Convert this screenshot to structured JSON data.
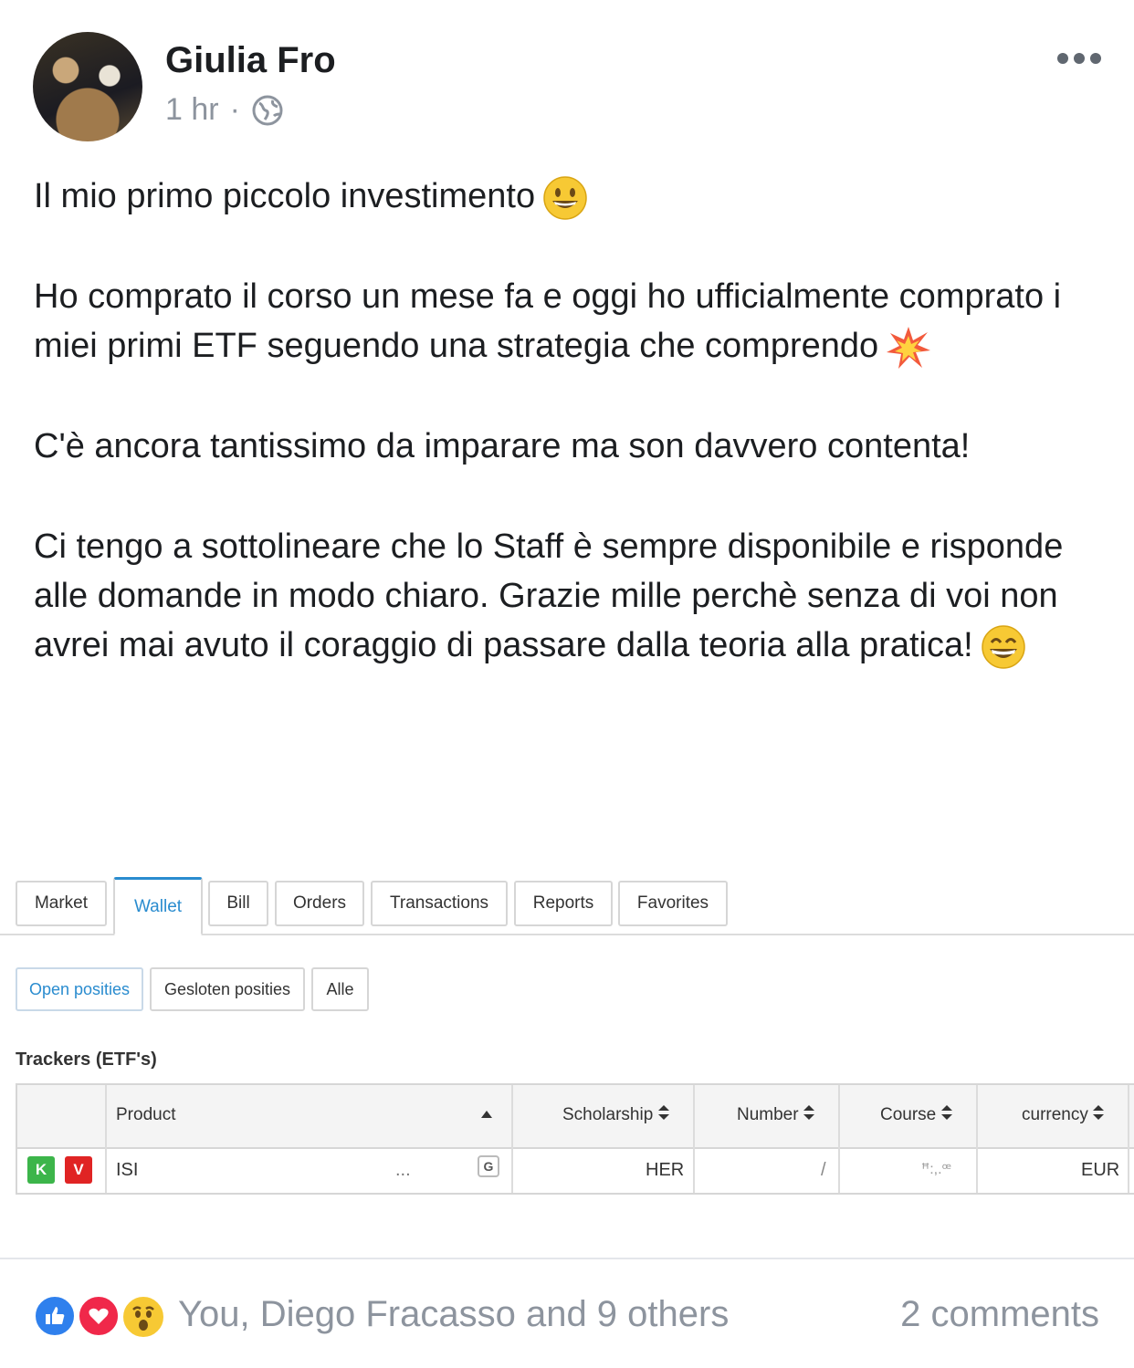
{
  "post": {
    "author": "Giulia Fro",
    "time": "1 hr",
    "separator": "·",
    "privacy_icon": "globe-icon",
    "more_icon": "more-options-icon",
    "paragraphs": [
      "Il mio primo piccolo investimento",
      "Ho comprato il corso un mese fa e oggi ho ufficialmente comprato i miei primi ETF  seguendo una strategia che comprendo",
      "C'è ancora tantissimo da imparare ma son davvero contenta!",
      "Ci tengo a sottolineare che lo Staff è sempre disponibile e risponde alle domande in modo chiaro. Grazie mille perchè senza di voi non avrei mai avuto il coraggio di passare dalla teoria alla pratica!"
    ],
    "emojis": [
      "grinning-face-icon",
      "collision-icon",
      "grinning-face-big-eyes-icon"
    ]
  },
  "screenshot": {
    "tabs": [
      "Market",
      "Wallet",
      "Bill",
      "Orders",
      "Transactions",
      "Reports",
      "Favorites"
    ],
    "active_tab": "Wallet",
    "subtabs": [
      "Open posities",
      "Gesloten posities",
      "Alle"
    ],
    "active_subtab": "Open posities",
    "section_title": "Trackers (ETF's)",
    "columns": [
      "Product",
      "Scholarship",
      "Number",
      "Course",
      "currency"
    ],
    "sort_icons": [
      "sort-up-icon",
      "sort-both-icon"
    ],
    "row": {
      "buy_badge": "K",
      "sell_badge": "V",
      "product": "ISI",
      "ellipsis": "...",
      "g_button": "G",
      "scholarship": "HER",
      "number": "/",
      "course": "ꟸ:,.ꟹ",
      "currency": "EUR"
    },
    "colors": {
      "active": "#2a8ccf",
      "buy": "#3cb54a",
      "sell": "#e02424"
    }
  },
  "footer": {
    "reaction_icons": [
      "like-icon",
      "love-icon",
      "wow-icon"
    ],
    "reactions_text": "You, Diego Fracasso and 9 others",
    "comments_text": "2 comments"
  }
}
